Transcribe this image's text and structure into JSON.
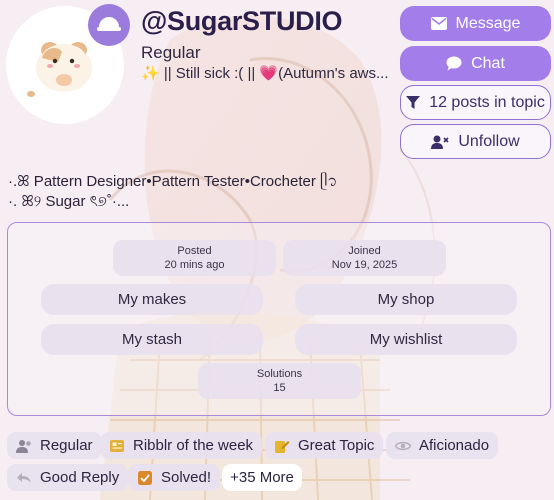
{
  "profile": {
    "username": "@SugarSTUDIO",
    "title": "Regular",
    "status": "✨ || Still sick :( || 💗(Autumn's aws...",
    "bio_line1": "·.ꕤ Pattern Designer•Pattern Tester•Crocheter ᥫ᭡",
    "bio_line2": "·. ꕤ୨ Sugar ৎ୭˚·..."
  },
  "actions": {
    "message": "Message",
    "chat": "Chat",
    "posts": "12 posts in topic",
    "unfollow": "Unfollow"
  },
  "stats": {
    "posted_label": "Posted",
    "posted_value": "20 mins ago",
    "joined_label": "Joined",
    "joined_value": "Nov 19, 2025",
    "solutions_label": "Solutions",
    "solutions_value": "15"
  },
  "links": {
    "makes": "My makes",
    "shop": "My shop",
    "stash": "My stash",
    "wishlist": "My wishlist"
  },
  "badges": [
    {
      "label": "Regular",
      "icon": "regular-icon"
    },
    {
      "label": "Ribblr of the week",
      "icon": "newspaper-icon"
    },
    {
      "label": "Great Topic",
      "icon": "pencil-note-icon"
    },
    {
      "label": "Aficionado",
      "icon": "eye-icon"
    },
    {
      "label": "Good Reply",
      "icon": "reply-arrow-icon"
    },
    {
      "label": "Solved!",
      "icon": "checkbox-icon"
    }
  ],
  "more_badges": "+35 More",
  "colors": {
    "accent": "#a37eea",
    "outline": "#8d72d4",
    "username": "#2a1f4a"
  }
}
